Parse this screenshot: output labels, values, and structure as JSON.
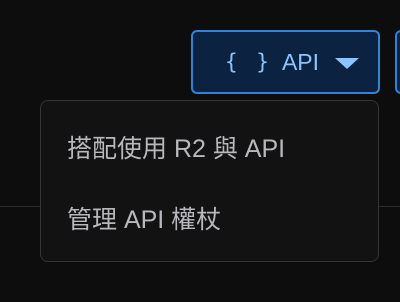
{
  "api_button": {
    "icon": "braces-icon",
    "icon_glyph": "{ }",
    "label": "API",
    "caret_icon": "caret-down-icon",
    "accent_color": "#2f83d8"
  },
  "menu": {
    "items": [
      {
        "label": "搭配使用 R2 與 API"
      },
      {
        "label": "管理 API 權杖"
      }
    ]
  }
}
